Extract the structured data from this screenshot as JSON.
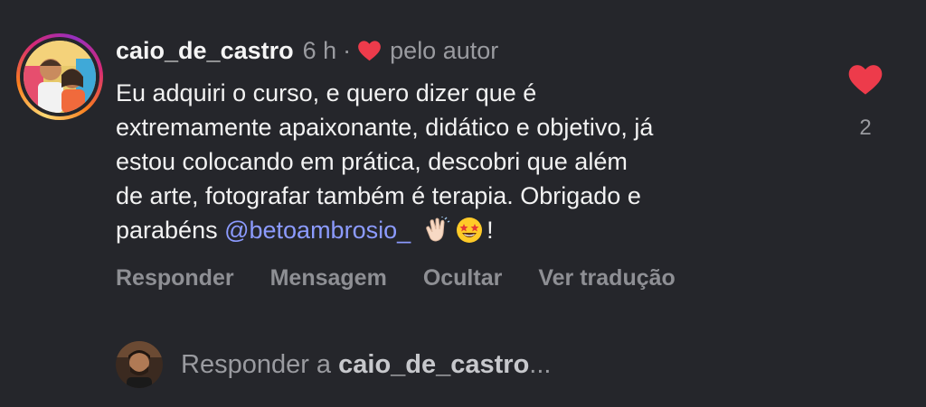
{
  "comment": {
    "username": "caio_de_castro",
    "time": "6 h",
    "separator": "·",
    "liked_by_author_label": "pelo autor",
    "text_lines": [
      "Eu adquiri o curso, e quero dizer que é",
      "extremamente apaixonante, didático e objetivo, já",
      "estou colocando em prática, descobri que além",
      "de arte, fotografar também é terapia. Obrigado e"
    ],
    "last_line_prefix": "parabéns ",
    "mention": "@betoambrosio_",
    "last_line_suffix": "!",
    "emojis": [
      "clapping-hands-emoji",
      "star-struck-emoji"
    ],
    "like_count": "2",
    "like_color": "#ed3b4b"
  },
  "actions": {
    "reply": "Responder",
    "message": "Mensagem",
    "hide": "Ocultar",
    "see_translation": "Ver tradução"
  },
  "reply_box": {
    "prefix": "Responder a ",
    "username": "caio_de_castro",
    "ellipsis": "..."
  },
  "icons": {
    "author_heart": "heart-icon",
    "like_heart": "heart-icon"
  },
  "colors": {
    "background": "#25262b",
    "mention": "#8c9bff",
    "muted_text": "#9a9ba0",
    "heart": "#ed3b4b"
  }
}
